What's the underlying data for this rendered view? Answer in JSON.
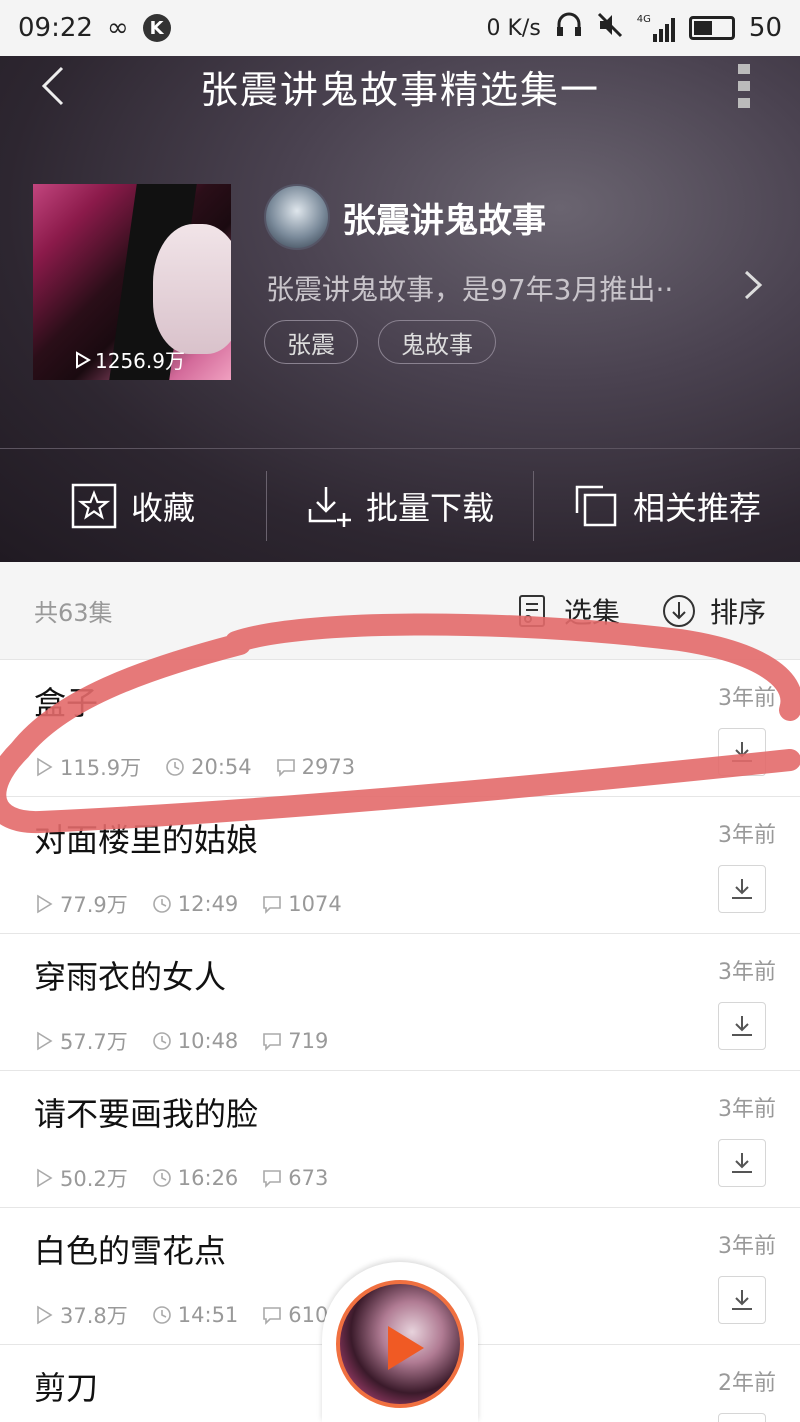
{
  "status": {
    "time": "09:22",
    "speed": "0 K/s",
    "battery": "50",
    "network": "4G",
    "battery_level": 0.5
  },
  "header": {
    "title": "张震讲鬼故事精选集一",
    "plays": "1256.9万",
    "author": "张震讲鬼故事",
    "description": "张震讲鬼故事，是97年3月推出··",
    "tags": [
      "张震",
      "鬼故事"
    ]
  },
  "actions": {
    "favorite": "收藏",
    "batch_download": "批量下载",
    "related": "相关推荐"
  },
  "list_header": {
    "count": "共63集",
    "select": "选集",
    "sort": "排序"
  },
  "episodes": [
    {
      "title": "盒子",
      "age": "3年前",
      "plays": "115.9万",
      "duration": "20:54",
      "comments": "2973"
    },
    {
      "title": "对面楼里的姑娘",
      "age": "3年前",
      "plays": "77.9万",
      "duration": "12:49",
      "comments": "1074"
    },
    {
      "title": "穿雨衣的女人",
      "age": "3年前",
      "plays": "57.7万",
      "duration": "10:48",
      "comments": "719"
    },
    {
      "title": "请不要画我的脸",
      "age": "3年前",
      "plays": "50.2万",
      "duration": "16:26",
      "comments": "673"
    },
    {
      "title": "白色的雪花点",
      "age": "3年前",
      "plays": "37.8万",
      "duration": "14:51",
      "comments": "610"
    },
    {
      "title": "剪刀",
      "age": "2年前",
      "plays": "",
      "duration": "",
      "comments": ""
    }
  ],
  "colors": {
    "accent": "#f05a24",
    "annotation": "#e36a6a"
  }
}
